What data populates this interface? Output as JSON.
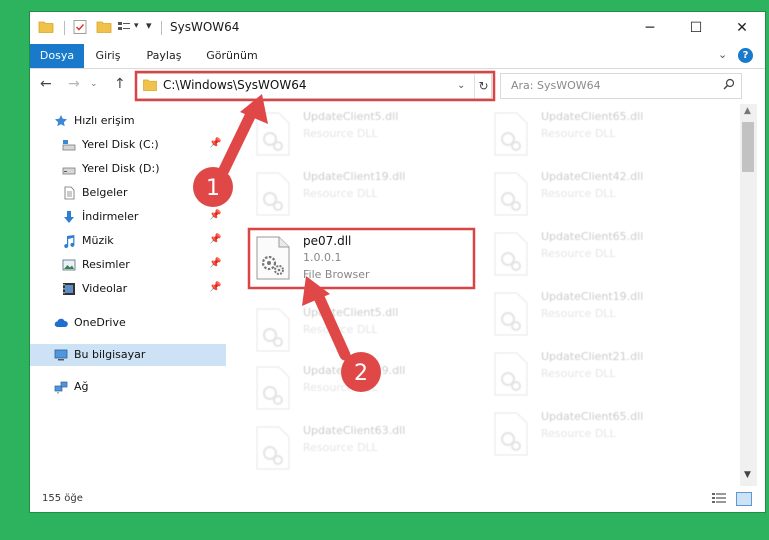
{
  "window": {
    "title": "SysWOW64",
    "controls": {
      "minimize": "─",
      "maximize": "☐",
      "close": "✕"
    }
  },
  "ribbon": {
    "tabs": [
      "Dosya",
      "Giriş",
      "Paylaş",
      "Görünüm"
    ],
    "help": "?"
  },
  "address": {
    "path": "C:\\Windows\\SysWOW64",
    "search_placeholder": "Ara: SysWOW64"
  },
  "nav_pane": {
    "items": [
      {
        "label": "Hızlı erişim",
        "icon": "star-icon",
        "pinned": false
      },
      {
        "label": "Yerel Disk (C:)",
        "icon": "drive-icon",
        "pinned": true
      },
      {
        "label": "Yerel Disk (D:)",
        "icon": "drive-icon",
        "pinned": false
      },
      {
        "label": "Belgeler",
        "icon": "document-icon",
        "pinned": true
      },
      {
        "label": "İndirmeler",
        "icon": "download-icon",
        "pinned": true
      },
      {
        "label": "Müzik",
        "icon": "music-icon",
        "pinned": true
      },
      {
        "label": "Resimler",
        "icon": "pictures-icon",
        "pinned": true
      },
      {
        "label": "Videolar",
        "icon": "video-icon",
        "pinned": true
      },
      {
        "label": "OneDrive",
        "icon": "cloud-icon",
        "pinned": false
      },
      {
        "label": "Bu bilgisayar",
        "icon": "computer-icon",
        "pinned": false,
        "selected": true
      },
      {
        "label": "Ağ",
        "icon": "network-icon",
        "pinned": false
      }
    ]
  },
  "files": {
    "left_column": [
      {
        "name": "UpdateClient5.dll",
        "desc": "Resource DLL"
      },
      {
        "name": "UpdateClient19.dll",
        "desc": "Resource DLL"
      },
      {
        "name": "pe07.dll",
        "version": "1.0.0.1",
        "desc": "File Browser",
        "highlighted": true
      },
      {
        "name": "UpdateClient5.dll",
        "desc": "Resource DLL"
      },
      {
        "name": "UpdateClient19.dll",
        "desc": "Resource DLL"
      },
      {
        "name": "UpdateClient63.dll",
        "desc": "Resource DLL"
      }
    ],
    "right_column": [
      {
        "name": "UpdateClient65.dll",
        "desc": "Resource DLL"
      },
      {
        "name": "UpdateClient42.dll",
        "desc": "Resource DLL"
      },
      {
        "name": "UpdateClient65.dll",
        "desc": "Resource DLL"
      },
      {
        "name": "UpdateClient19.dll",
        "desc": "Resource DLL"
      },
      {
        "name": "UpdateClient21.dll",
        "desc": "Resource DLL"
      },
      {
        "name": "UpdateClient65.dll",
        "desc": "Resource DLL"
      }
    ]
  },
  "status": {
    "item_count": "155 öğe"
  },
  "annotations": {
    "step1": "1",
    "step2": "2",
    "color": "#e04848"
  },
  "colors": {
    "background": "#2db25e",
    "accent": "#1979ca",
    "selected": "#cde2f4",
    "highlight_border": "#d94545"
  }
}
